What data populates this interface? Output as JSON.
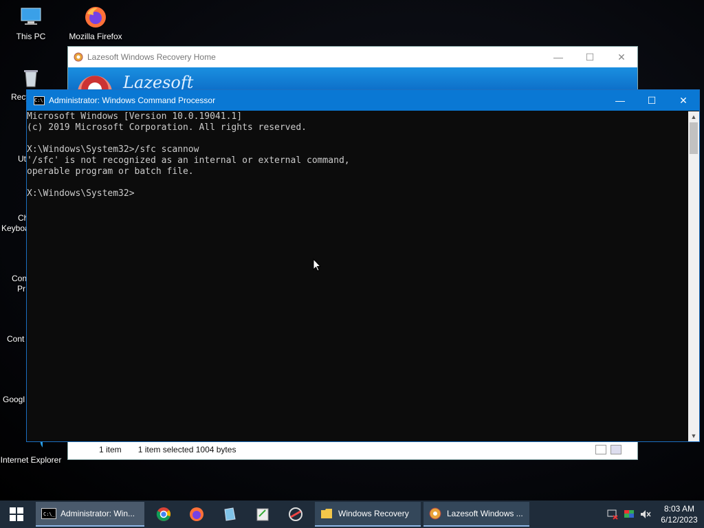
{
  "desktop": {
    "icons": [
      {
        "label": "This PC",
        "icon": "this-pc-icon"
      },
      {
        "label": "Mozilla Firefox",
        "icon": "firefox-icon"
      },
      {
        "label": "Recy",
        "icon": "recycle-bin-icon"
      },
      {
        "label": "Ut",
        "icon": "utility-icon"
      },
      {
        "label": "Ch",
        "label2": "Keyboa",
        "icon": "keyboard-icon"
      },
      {
        "label": "Con",
        "label2": "Pr",
        "icon": "command-prompt-icon"
      },
      {
        "label": "Cont",
        "icon": "control-panel-icon"
      },
      {
        "label": "Googl",
        "icon": "chrome-icon"
      },
      {
        "label": "Internet Explorer",
        "icon": "ie-icon"
      }
    ]
  },
  "lazesoft_window": {
    "title": "Lazesoft Windows Recovery Home",
    "brand": "Lazesoft"
  },
  "explorer_status": {
    "count": "1 item",
    "selection": "1 item selected  1004 bytes"
  },
  "cmd": {
    "title": "Administrator: Windows Command Processor",
    "lines": [
      "Microsoft Windows [Version 10.0.19041.1]",
      "(c) 2019 Microsoft Corporation. All rights reserved.",
      "",
      "X:\\Windows\\System32>/sfc scannow",
      "'/sfc' is not recognized as an internal or external command,",
      "operable program or batch file.",
      "",
      "X:\\Windows\\System32>"
    ]
  },
  "taskbar": {
    "cmd_button": "Administrator: Win...",
    "explorer_button": "Windows Recovery",
    "lazesoft_button": "Lazesoft Windows ...",
    "time": "8:03 AM",
    "date": "6/12/2023"
  },
  "colors": {
    "accent": "#0a78d4",
    "console_bg": "#0c0c0c",
    "console_fg": "#cccccc",
    "taskbar": "#1f2c3a"
  }
}
